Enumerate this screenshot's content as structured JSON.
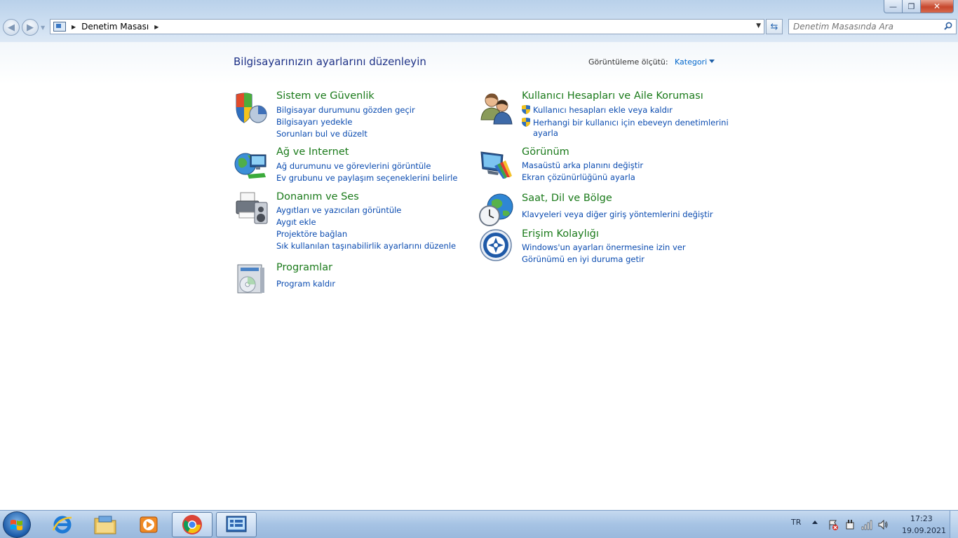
{
  "window": {
    "address_crumb": "Denetim Masası",
    "search_placeholder": "Denetim Masasında Ara",
    "caption": {
      "minimize": "—",
      "maximize": "❐",
      "close": "✕"
    }
  },
  "header": {
    "title": "Bilgisayarınızın ayarlarını düzenleyin",
    "view_by_label": "Görüntüleme ölçütü:",
    "view_by_value": "Kategori"
  },
  "categories": {
    "system": {
      "title": "Sistem ve Güvenlik",
      "icon": "shield-security-icon",
      "links": [
        "Bilgisayar durumunu gözden geçir",
        "Bilgisayarı yedekle",
        "Sorunları bul ve düzelt"
      ]
    },
    "network": {
      "title": "Ağ ve Internet",
      "icon": "network-globe-icon",
      "links": [
        "Ağ durumunu ve görevlerini görüntüle",
        "Ev grubunu ve paylaşım seçeneklerini belirle"
      ]
    },
    "hardware": {
      "title": "Donanım ve Ses",
      "icon": "printer-speaker-icon",
      "links": [
        "Aygıtları ve yazıcıları görüntüle",
        "Aygıt ekle",
        "Projektöre bağlan",
        "Sık kullanılan taşınabilirlik ayarlarını düzenle"
      ]
    },
    "programs": {
      "title": "Programlar",
      "icon": "programs-disc-icon",
      "links": [
        "Program kaldır"
      ]
    },
    "users": {
      "title": "Kullanıcı Hesapları ve Aile Koruması",
      "icon": "users-icon",
      "links": [
        "Kullanıcı hesapları ekle veya kaldır",
        "Herhangi bir kullanıcı için ebeveyn denetimlerini",
        "ayarla"
      ]
    },
    "appearance": {
      "title": "Görünüm",
      "icon": "monitor-palette-icon",
      "links": [
        "Masaüstü arka planını değiştir",
        "Ekran çözünürlüğünü ayarla"
      ]
    },
    "clock": {
      "title": "Saat, Dil ve Bölge",
      "icon": "clock-globe-icon",
      "links": [
        "Klavyeleri veya diğer giriş yöntemlerini değiştir"
      ]
    },
    "access": {
      "title": "Erişim Kolaylığı",
      "icon": "ease-of-access-icon",
      "links": [
        "Windows'un ayarları önermesine izin ver",
        "Görünümü en iyi duruma getir"
      ]
    }
  },
  "taskbar": {
    "apps": [
      "internet-explorer-icon",
      "file-explorer-icon",
      "media-player-icon",
      "chrome-icon",
      "control-panel-icon"
    ],
    "language": "TR",
    "time": "17:23",
    "date": "19.09.2021"
  }
}
